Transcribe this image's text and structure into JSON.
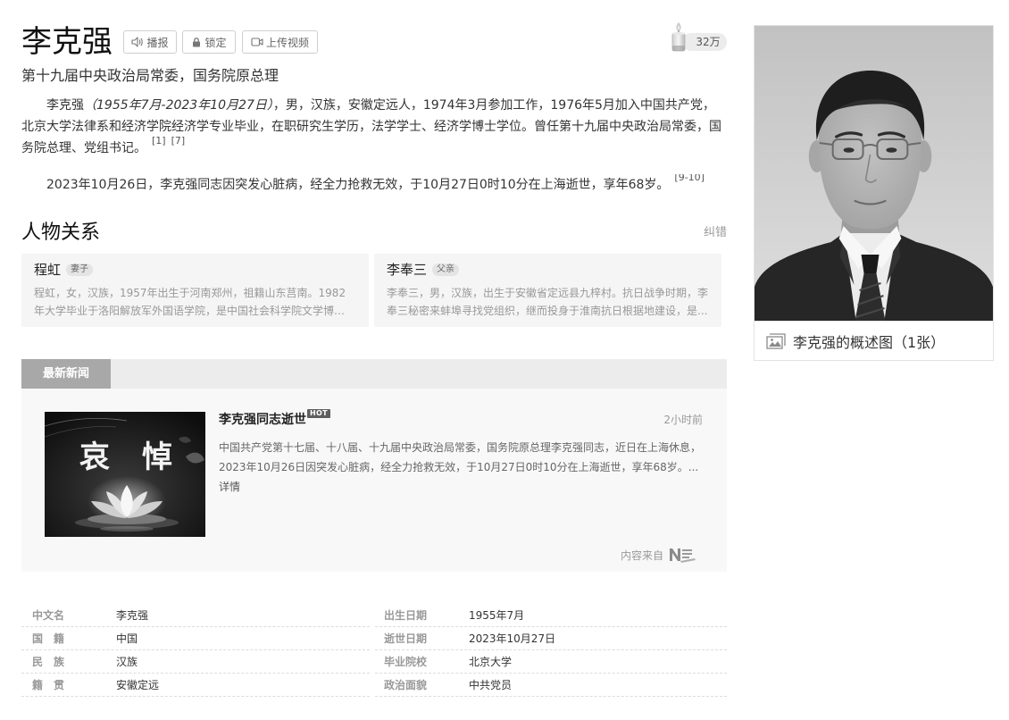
{
  "header": {
    "title": "李克强",
    "actions": [
      {
        "label": "播报",
        "icon": "speaker-icon"
      },
      {
        "label": "锁定",
        "icon": "lock-icon"
      },
      {
        "label": "上传视频",
        "icon": "video-icon"
      }
    ],
    "candle": {
      "icon": "candle-icon",
      "count": "32万"
    }
  },
  "summary": {
    "subtitle": "第十九届中央政治局常委，国务院原总理",
    "paragraph1": {
      "name": "李克强",
      "dates": "（1955年7月-2023年10月27日）",
      "text": "，男，汉族，安徽定远人，1974年3月参加工作，1976年5月加入中国共产党，北京大学法律系和经济学院经济学专业毕业，在职研究生学历，法学学士、经济学博士学位。曾任第十九届中央政治局常委，国务院总理、党组书记。",
      "refs": [
        "[1]",
        "[7]"
      ]
    },
    "paragraph2": {
      "text": "2023年10月26日，李克强同志因突发心脏病，经全力抢救无效，于10月27日0时10分在上海逝世，享年68岁。",
      "refs": [
        "[9-10]"
      ]
    }
  },
  "relations": {
    "title": "人物关系",
    "correction_label": "纠错",
    "items": [
      {
        "name": "程虹",
        "relation": "妻子",
        "description": "程虹，女，汉族，1957年出生于河南郑州，祖籍山东莒南。1982年大学毕业于洛阳解放军外国语学院，是中国社会科学院文学博士，..."
      },
      {
        "name": "李奉三",
        "relation": "父亲",
        "description": "李奉三，男，汉族，出生于安徽省定远县九梓村。抗日战争时期，李奉三秘密来蚌埠寻找党组织，继而投身于淮南抗日根据地建设，是..."
      }
    ]
  },
  "news": {
    "tab_label": "最新新闻",
    "item": {
      "image_text": [
        "哀",
        "悼"
      ],
      "title": "李克强同志逝世",
      "badge": "HOT",
      "time": "2小时前",
      "summary": "中国共产党第十七届、十八届、十九届中央政治局常委，国务院原总理李克强同志，近日在上海休息，2023年10月26日因突发心脏病，经全力抢救无效，于10月27日0时10分在上海逝世，享年68岁。...",
      "more_label": "详情"
    },
    "source": {
      "label": "内容来自",
      "logo_icon": "news-source-logo"
    }
  },
  "basic_info": {
    "left": [
      {
        "label": "中文名",
        "value": "李克强"
      },
      {
        "label": "国　籍",
        "value": "中国"
      },
      {
        "label": "民　族",
        "value": "汉族"
      },
      {
        "label": "籍　贯",
        "value": "安徽定远"
      }
    ],
    "right": [
      {
        "label": "出生日期",
        "value": "1955年7月"
      },
      {
        "label": "逝世日期",
        "value": "2023年10月27日"
      },
      {
        "label": "毕业院校",
        "value": "北京大学"
      },
      {
        "label": "政治面貌",
        "value": "中共党员"
      }
    ]
  },
  "album": {
    "caption": "李克强的概述图（1张）",
    "icon": "image-icon"
  }
}
